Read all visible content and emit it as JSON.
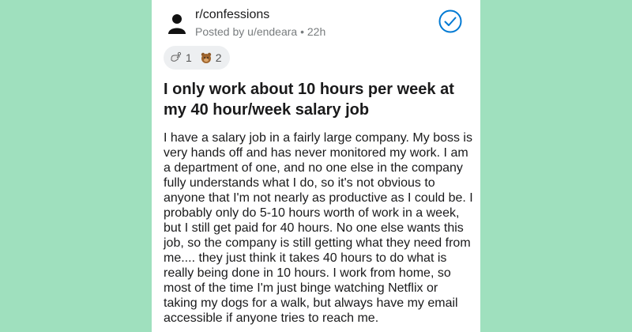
{
  "post": {
    "subreddit": "r/confessions",
    "byline": "Posted by u/endeara • 22h",
    "awards": [
      {
        "icon": "helpful-award-icon",
        "count": "1"
      },
      {
        "icon": "wholesome-bear-award-icon",
        "count": "2"
      }
    ],
    "title": "I only work about 10 hours per week at my 40 hour/week salary job",
    "body": "I have a salary job in a fairly large company. My boss is very hands off and has never monitored my work. I am a department of one, and no one else in the company fully understands what I do, so it's not obvious to anyone that I'm not nearly as productive as I could be. I probably only do 5-10 hours worth of work in a week, but I still get paid for 40 hours. No one else wants this job, so the company is still getting what they need from me.... they just think it takes 40 hours to do what is really being done in 10 hours. I work from home, so most of the time I'm just binge watching Netflix or taking my dogs for a walk, but always have my email accessible if anyone tries to reach me."
  },
  "colors": {
    "background": "#9fe0be",
    "card": "#ffffff",
    "accent": "#0079d3"
  },
  "icons": {
    "avatar": "user-icon",
    "joined": "check-circle-icon"
  }
}
